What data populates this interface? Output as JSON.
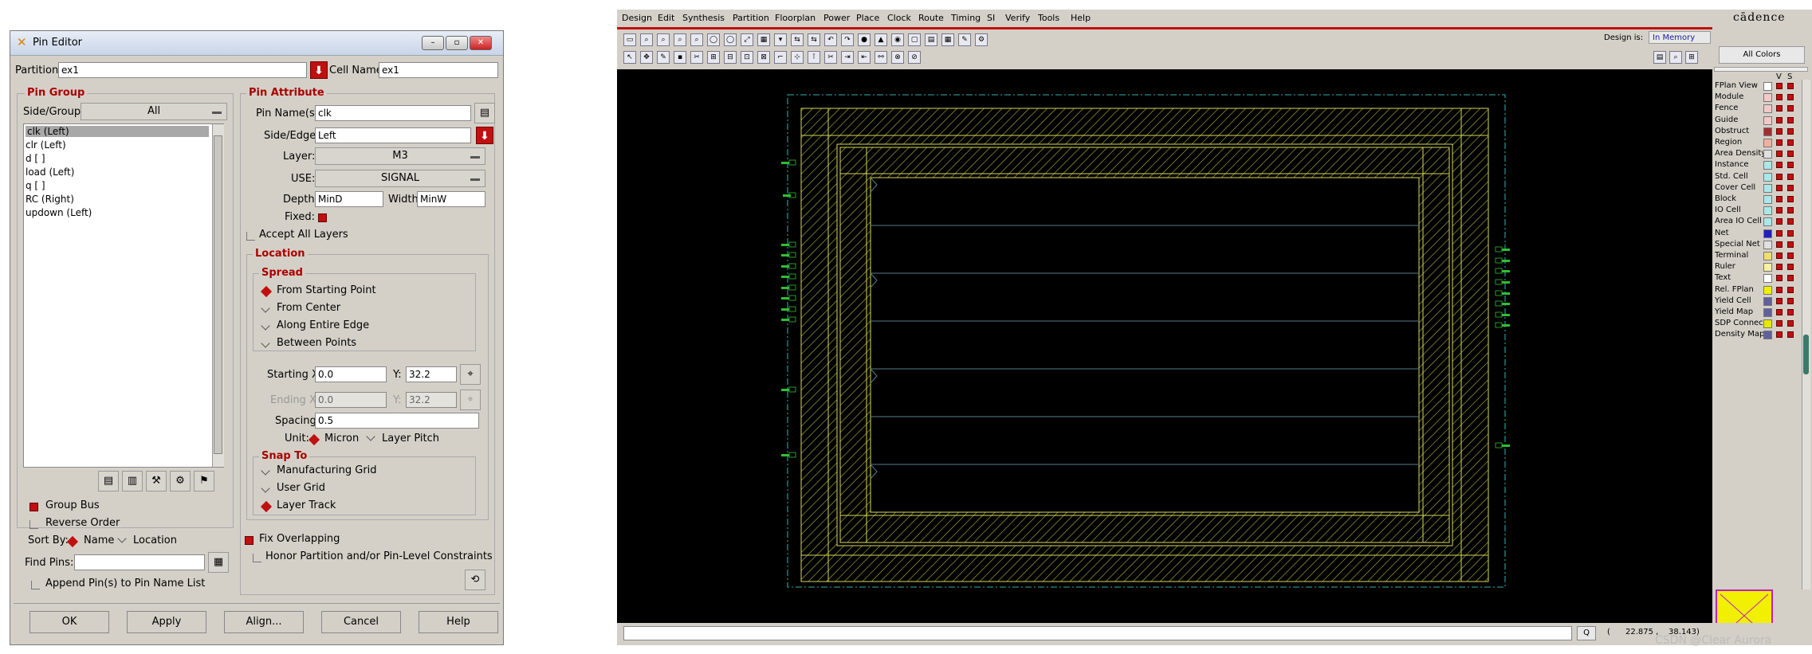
{
  "pin_editor": {
    "title": "Pin Editor",
    "partition_label": "Partition:",
    "partition_value": "ex1",
    "cell_name_label": "Cell Name:",
    "cell_name_value": "ex1",
    "pin_group": {
      "title": "Pin Group",
      "side_group_label": "Side/Group:",
      "side_group_value": "All",
      "pins": [
        "clk (Left)",
        "clr (Left)",
        "d [ ]",
        "load (Left)",
        "q [ ]",
        "RC (Right)",
        "updown (Left)"
      ],
      "selected_index": 0,
      "group_bus_label": "Group Bus",
      "reverse_order_label": "Reverse Order",
      "sort_by_label": "Sort By:",
      "sort_name_label": "Name",
      "sort_location_label": "Location",
      "find_pins_label": "Find Pins:",
      "find_pins_value": "",
      "append_label": "Append Pin(s) to Pin Name List"
    },
    "pin_attribute": {
      "title": "Pin Attribute",
      "pin_names_label": "Pin Name(s):",
      "pin_names_value": "clk",
      "side_edge_label": "Side/Edge:",
      "side_edge_value": "Left",
      "layer_label": "Layer:",
      "layer_value": "M3",
      "use_label": "USE:",
      "use_value": "SIGNAL",
      "depth_label": "Depth:",
      "depth_value": "MinD",
      "width_label": "Width:",
      "width_value": "MinW",
      "fixed_label": "Fixed:",
      "accept_all_layers_label": "Accept All Layers"
    },
    "location": {
      "title": "Location",
      "spread_title": "Spread",
      "spread_options": [
        "From Starting Point",
        "From Center",
        "Along Entire Edge",
        "Between Points"
      ],
      "spread_selected": 0,
      "starting_x_label": "Starting X:",
      "starting_x_value": "0.0",
      "starting_y_label": "Y:",
      "starting_y_value": "32.2",
      "ending_x_label": "Ending X:",
      "ending_x_value": "0.0",
      "ending_y_label": "Y:",
      "ending_y_value": "32.2",
      "spacing_label": "Spacing:",
      "spacing_value": "0.5",
      "unit_label": "Unit:",
      "unit_micron": "Micron",
      "unit_layer_pitch": "Layer Pitch",
      "snap_title": "Snap To",
      "snap_options": [
        "Manufacturing Grid",
        "User Grid",
        "Layer Track"
      ],
      "snap_selected": 2
    },
    "fix_overlapping_label": "Fix Overlapping",
    "honor_label": "Honor Partition and/or Pin-Level Constraints",
    "buttons": {
      "ok": "OK",
      "apply": "Apply",
      "align": "Align...",
      "cancel": "Cancel",
      "help": "Help"
    }
  },
  "cadence": {
    "menu": [
      "Design",
      "Edit",
      "Synthesis",
      "Partition",
      "Floorplan",
      "Power",
      "Place",
      "Clock",
      "Route",
      "Timing",
      "SI",
      "Verify",
      "Tools",
      "Help"
    ],
    "brand": "cādence",
    "design_is_label": "Design is:",
    "design_is_value": "In Memory",
    "all_colors_label": "All Colors",
    "vs_header": [
      "V",
      "S"
    ],
    "legend": [
      {
        "name": "FPlan View",
        "color": "#ffffff"
      },
      {
        "name": "Module",
        "color": "#f4c8c8"
      },
      {
        "name": "Fence",
        "color": "#f4c8c8"
      },
      {
        "name": "Guide",
        "color": "#f4c8c8"
      },
      {
        "name": "Obstruct",
        "color": "#a03030"
      },
      {
        "name": "Region",
        "color": "#f0b0a0"
      },
      {
        "name": "Area Density",
        "color": "#e0e0e0"
      },
      {
        "name": "Instance",
        "color": "#a8e8e8"
      },
      {
        "name": "Std. Cell",
        "color": "#a8e8e8"
      },
      {
        "name": "Cover Cell",
        "color": "#a8e8e8"
      },
      {
        "name": "Block",
        "color": "#a8e8e8"
      },
      {
        "name": "IO Cell",
        "color": "#a8e8e8"
      },
      {
        "name": "Area IO Cell",
        "color": "#a8e8e8"
      },
      {
        "name": "Net",
        "color": "#2020c0"
      },
      {
        "name": "Special Net",
        "color": "#e0e0e0"
      },
      {
        "name": "Terminal",
        "color": "#f0e060"
      },
      {
        "name": "Ruler",
        "color": "#f8f0a0"
      },
      {
        "name": "Text",
        "color": "#ffffff"
      },
      {
        "name": "Rel. FPlan",
        "color": "#f0f000"
      },
      {
        "name": "Yield Cell",
        "color": "#6060a0"
      },
      {
        "name": "Yield Map",
        "color": "#6060a0"
      },
      {
        "name": "SDP Connect",
        "color": "#e8e800"
      },
      {
        "name": "Density Map",
        "color": "#6060a0"
      }
    ],
    "status_search": "Q",
    "coords": "(      22.875 ,    38.143)",
    "watermark": "CSDN @Clear Aurora"
  }
}
